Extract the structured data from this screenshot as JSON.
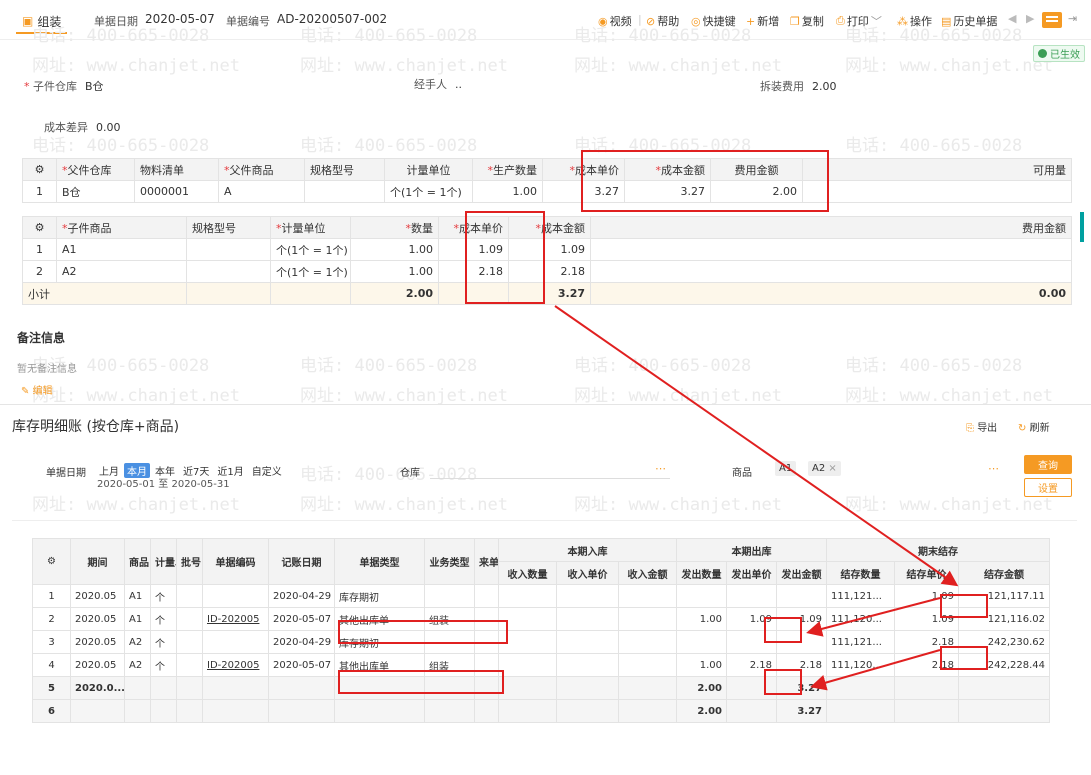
{
  "topbar": {
    "tab_label": "组装",
    "doc_date_label": "单据日期",
    "doc_date": "2020-05-07",
    "doc_no_label": "单据编号",
    "doc_no": "AD-20200507-002",
    "tools": [
      "视频",
      "帮助",
      "快捷键",
      "新增",
      "复制",
      "打印",
      "操作",
      "历史单据"
    ]
  },
  "watermark": {
    "phone": "电话: 400-665-0028",
    "site": "网址: www.chanjet.net"
  },
  "status": "已生效",
  "form": {
    "child_wh_label": "子件仓库",
    "child_wh": "B仓",
    "handler_label": "经手人",
    "handler": "..",
    "disassembly_fee_label": "拆装费用",
    "disassembly_fee": "2.00",
    "cost_diff_label": "成本差异",
    "cost_diff": "0.00"
  },
  "parent_table": {
    "headers": [
      "父件仓库",
      "物料清单",
      "父件商品",
      "规格型号",
      "计量单位",
      "生产数量",
      "成本单价",
      "成本金额",
      "费用金额",
      "可用量"
    ],
    "row": {
      "idx": "1",
      "wh": "B仓",
      "bom": "0000001",
      "goods": "A",
      "spec": "",
      "unit": "个(1个 = 1个)",
      "qty": "1.00",
      "price": "3.27",
      "amount": "3.27",
      "fee": "2.00",
      "avail": ""
    }
  },
  "child_table": {
    "headers": [
      "子件商品",
      "规格型号",
      "计量单位",
      "数量",
      "成本单价",
      "成本金额",
      "费用金额"
    ],
    "rows": [
      {
        "idx": "1",
        "goods": "A1",
        "spec": "",
        "unit": "个(1个 = 1个)",
        "qty": "1.00",
        "price": "1.09",
        "amount": "1.09",
        "fee": ""
      },
      {
        "idx": "2",
        "goods": "A2",
        "spec": "",
        "unit": "个(1个 = 1个)",
        "qty": "1.00",
        "price": "2.18",
        "amount": "2.18",
        "fee": ""
      }
    ],
    "subtotal_label": "小计",
    "subtotal_qty": "2.00",
    "subtotal_amount": "3.27",
    "subtotal_fee": "0.00"
  },
  "remarks": {
    "title": "备注信息",
    "empty": "暂无备注信息",
    "edit": "编辑"
  },
  "ledger": {
    "title": "库存明细账 (按仓库+商品)",
    "export": "导出",
    "refresh": "刷新",
    "date_label": "单据日期",
    "date_chips": [
      "上月",
      "本月",
      "本年",
      "近7天",
      "近1月",
      "自定义"
    ],
    "date_range": "2020-05-01 至 2020-05-31",
    "wh_label": "仓库",
    "goods_label": "商品",
    "goods_tags": [
      "A1",
      "A2"
    ],
    "query": "查询",
    "settings": "设置",
    "group_in": "本期入库",
    "group_out": "本期出库",
    "group_end": "期末结存",
    "headers": [
      "期间",
      "商品",
      "计量单位",
      "批号",
      "单据编码",
      "记账日期",
      "单据类型",
      "业务类型",
      "来单位",
      "收入数量",
      "收入单价",
      "收入金额",
      "发出数量",
      "发出单价",
      "发出金额",
      "结存数量",
      "结存单价",
      "结存金额"
    ],
    "header_short": {
      "unit": "计量单",
      "batch": "批号",
      "from": "来单位"
    },
    "rows": [
      {
        "idx": "1",
        "period": "2020.05",
        "goods": "A1",
        "unit": "个",
        "code": "",
        "date": "2020-04-29",
        "type": "库存期初",
        "biz": "",
        "out_qty": "",
        "out_price": "",
        "out_amt": "",
        "end_qty": "111,121...",
        "end_price": "1.09",
        "end_amt": "121,117.11"
      },
      {
        "idx": "2",
        "period": "2020.05",
        "goods": "A1",
        "unit": "个",
        "code": "ID-202005",
        "date": "2020-05-07",
        "type": "其他出库单",
        "biz": "组装",
        "out_qty": "1.00",
        "out_price": "1.09",
        "out_amt": "1.09",
        "end_qty": "111,120...",
        "end_price": "1.09",
        "end_amt": "121,116.02"
      },
      {
        "idx": "3",
        "period": "2020.05",
        "goods": "A2",
        "unit": "个",
        "code": "",
        "date": "2020-04-29",
        "type": "库存期初",
        "biz": "",
        "out_qty": "",
        "out_price": "",
        "out_amt": "",
        "end_qty": "111,121...",
        "end_price": "2.18",
        "end_amt": "242,230.62"
      },
      {
        "idx": "4",
        "period": "2020.05",
        "goods": "A2",
        "unit": "个",
        "code": "ID-202005",
        "date": "2020-05-07",
        "type": "其他出库单",
        "biz": "组装",
        "out_qty": "1.00",
        "out_price": "2.18",
        "out_amt": "2.18",
        "end_qty": "111,120...",
        "end_price": "2.18",
        "end_amt": "242,228.44"
      }
    ],
    "sum_rows": [
      {
        "idx": "5",
        "period": "2020.0...",
        "out_qty": "2.00",
        "out_amt": "3.27"
      },
      {
        "idx": "6",
        "period": "",
        "out_qty": "2.00",
        "out_amt": "3.27"
      }
    ]
  },
  "colors": {
    "accent": "#f59a23",
    "highlight": "#e02020",
    "status": "#3b9e55"
  }
}
